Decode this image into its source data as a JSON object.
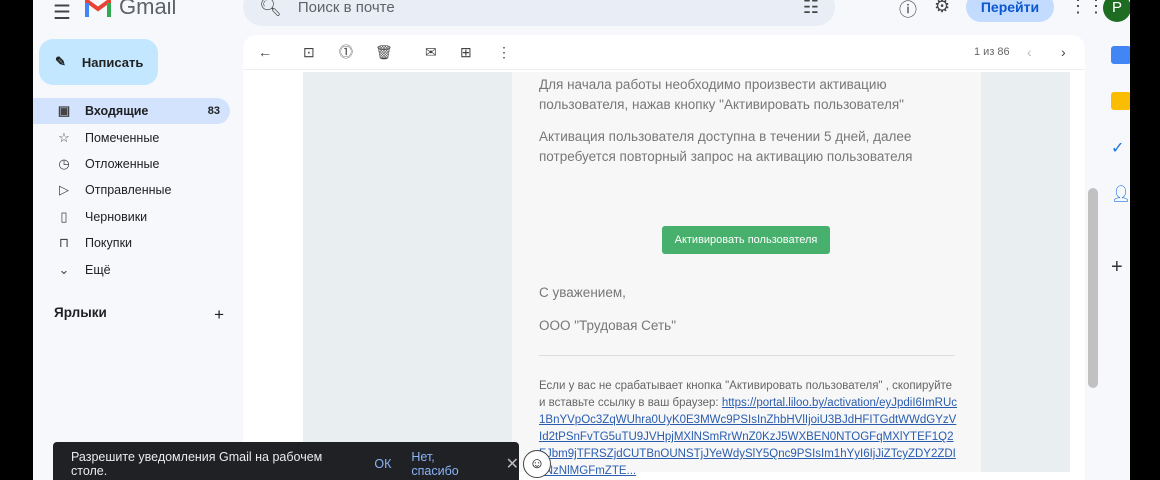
{
  "header": {
    "app_name": "Gmail",
    "search_placeholder": "Поиск в почте",
    "go_label": "Перейти",
    "avatar_letter": "P"
  },
  "sidebar": {
    "compose": "Написать",
    "items": [
      {
        "label": "Входящие",
        "count": "83",
        "icon": "inbox-icon"
      },
      {
        "label": "Помеченные",
        "icon": "star-icon"
      },
      {
        "label": "Отложенные",
        "icon": "clock-icon"
      },
      {
        "label": "Отправленные",
        "icon": "send-icon"
      },
      {
        "label": "Черновики",
        "icon": "draft-icon"
      },
      {
        "label": "Покупки",
        "icon": "shopping-icon"
      },
      {
        "label": "Ещё",
        "icon": "chevron-down-icon"
      }
    ],
    "labels_title": "Ярлыки"
  },
  "toolbar": {
    "pagination": "1 из 86"
  },
  "email": {
    "p1": "Для начала работы необходимо произвести активацию пользователя, нажав кнопку \"Активировать пользователя\"",
    "p2": "Активация пользователя доступна в течении 5 дней, далее потребуется повторный запрос на активацию пользователя",
    "button": "Активировать пользователя",
    "regards": "С уважением,",
    "company": "ООО \"Трудовая Сеть\"",
    "fallback": "Если у вас не срабатывает кнопка \"Активировать пользователя\" , скопируйте и вставьте ссылку в ваш браузер: ",
    "link": "https://portal.liloo.by/activation/eyJpdiI6ImRUc1BnYVpOc3ZqWUhra0UyK0E3MWc9PSIsInZhbHVlIjoiU3BJdHFITGdtWWdGYzVId2tPSnFvTG5uTU9JVHpjMXlNSmRrWnZ0KzJ5WXBEN0NTOGFqMXlYTEF1Q2FJbm9jTFRSZjdCUTBnOUNSTjJYeWdySlY5Qnc9PSIsIm1hYyI6IjJiZTcyZDY2ZDIxNzNlMGFmZTE..."
  },
  "toast": {
    "message": "Разрешите уведомления Gmail на рабочем столе.",
    "ok": "ОК",
    "no": "Нет, спасибо"
  }
}
